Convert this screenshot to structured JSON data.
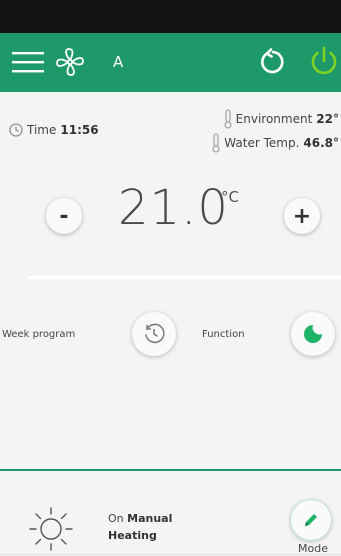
{
  "header": {
    "mode_letter": "A"
  },
  "status": {
    "time_label": "Time",
    "time_value": "11:56",
    "environment_label": "Environment",
    "environment_value": "22°",
    "water_label": "Water Temp.",
    "water_value": "46.8°"
  },
  "setpoint": {
    "value": "21.0",
    "unit": "°C",
    "minus_label": "-",
    "plus_label": "+"
  },
  "controls": {
    "week_program_label": "Week program",
    "function_label": "Function"
  },
  "footer": {
    "state_prefix": "On",
    "state_mode": "Manual",
    "state_function": "Heating",
    "mode_button_label": "Mode"
  },
  "colors": {
    "accent": "#1e9a6a",
    "power": "#7ed321"
  },
  "icons": [
    "menu-icon",
    "fan-icon",
    "refresh-icon",
    "power-icon",
    "clock-icon",
    "thermometer-icon",
    "week-clock-icon",
    "moon-icon",
    "sun-icon",
    "pencil-icon"
  ]
}
